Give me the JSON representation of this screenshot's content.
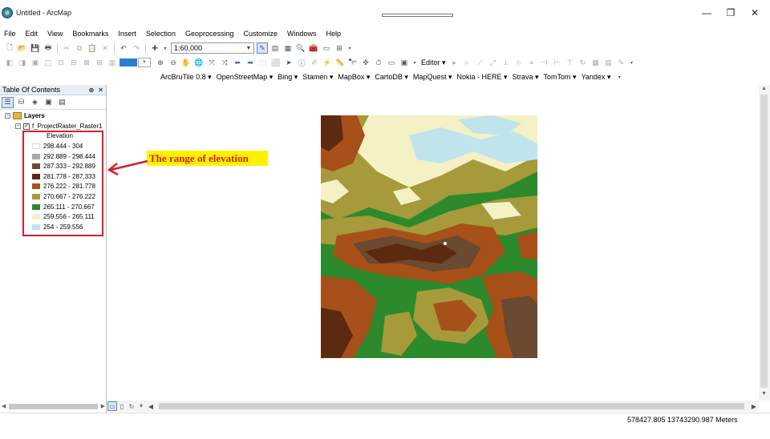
{
  "window": {
    "title": "Untitled - ArcMap",
    "minimize": "—",
    "maximize": "❐",
    "close": "✕"
  },
  "menu": [
    "File",
    "Edit",
    "View",
    "Bookmarks",
    "Insert",
    "Selection",
    "Geoprocessing",
    "Customize",
    "Windows",
    "Help"
  ],
  "standard_toolbar": {
    "scale": "1:60,000"
  },
  "editor_toolbar": {
    "editor_label": "Editor ▾"
  },
  "tiles_toolbar": [
    "ArcBruTile 0.8 ▾",
    "OpenStreetMap ▾",
    "Bing ▾",
    "Stamen ▾",
    "MapBox ▾",
    "CartoDB ▾",
    "MapQuest ▾",
    "Nokia - HERE ▾",
    "Strava ▾",
    "TomTom ▾",
    "Yandex ▾"
  ],
  "toc": {
    "title": "Table Of Contents",
    "pin": "⊕",
    "close": "✕",
    "layers_label": "Layers",
    "layer_name": "f_ProjectRaster_Raster1",
    "legend_title": "Elevation",
    "legend": [
      {
        "label": "298.444 - 304",
        "color": "#ffffff"
      },
      {
        "label": "292.889 - 298.444",
        "color": "#a8a8a8"
      },
      {
        "label": "287.333 - 292.889",
        "color": "#6a4a30"
      },
      {
        "label": "281.778 - 287.333",
        "color": "#5c2a10"
      },
      {
        "label": "276.222 - 281.778",
        "color": "#a8501a"
      },
      {
        "label": "270.667 - 276.222",
        "color": "#a69a3a"
      },
      {
        "label": "265.111 - 270.667",
        "color": "#2c8a2c"
      },
      {
        "label": "259.556 - 265.111",
        "color": "#f4f1c4"
      },
      {
        "label": "254 - 259.556",
        "color": "#c0e4ec"
      }
    ]
  },
  "annotation": {
    "text": "The range of elevation",
    "text_color": "#d32020",
    "background": "#fff200"
  },
  "status": {
    "coordinates": "578427.805  13743290.987 Meters"
  }
}
